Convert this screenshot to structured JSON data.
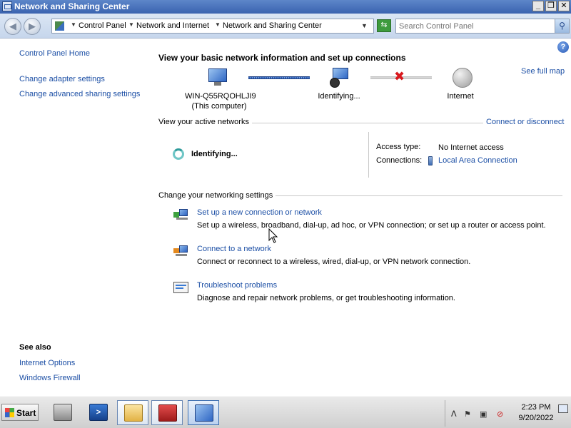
{
  "window": {
    "title": "Network and Sharing Center",
    "buttons": [
      "_",
      "❐",
      "✕"
    ]
  },
  "nav": {
    "back_icon": "back-arrow-icon",
    "forward_icon": "forward-arrow-icon",
    "breadcrumbs": [
      "Control Panel",
      "Network and Internet",
      "Network and Sharing Center"
    ],
    "search_placeholder": "Search Control Panel"
  },
  "sidebar": {
    "home": "Control Panel Home",
    "links": [
      "Change adapter settings",
      "Change advanced sharing settings"
    ],
    "see_also_title": "See also",
    "see_also": [
      "Internet Options",
      "Windows Firewall"
    ]
  },
  "main": {
    "heading": "View your basic network information and set up connections",
    "see_full_map": "See full map",
    "map": {
      "computer_name": "WIN-Q55RQOHLJI9",
      "computer_sub": "(This computer)",
      "middle": "Identifying...",
      "internet": "Internet"
    },
    "active_networks_title": "View your active networks",
    "connect_link": "Connect or disconnect",
    "identifying": "Identifying...",
    "access_type_label": "Access type:",
    "access_type_value": "No Internet access",
    "connections_label": "Connections:",
    "connections_value": "Local Area Connection",
    "settings_title": "Change your networking settings",
    "tasks": [
      {
        "title": "Set up a new connection or network",
        "desc": "Set up a wireless, broadband, dial-up, ad hoc, or VPN connection; or set up a router or access point.",
        "icon": "new-connection-icon"
      },
      {
        "title": "Connect to a network",
        "desc": "Connect or reconnect to a wireless, wired, dial-up, or VPN network connection.",
        "icon": "connect-network-icon"
      },
      {
        "title": "Troubleshoot problems",
        "desc": "Diagnose and repair network problems, or get troubleshooting information.",
        "icon": "troubleshoot-icon"
      }
    ]
  },
  "taskbar": {
    "start": "Start",
    "pinned": [
      "server-manager-icon",
      "powershell-icon",
      "explorer-icon",
      "toolbox-icon",
      "network-center-icon"
    ],
    "clock_time": "2:23 PM",
    "clock_date": "9/20/2022"
  },
  "colors": {
    "link": "#1c4fa5",
    "titlebar": "#3a63b0",
    "error_x": "#d8181d"
  }
}
